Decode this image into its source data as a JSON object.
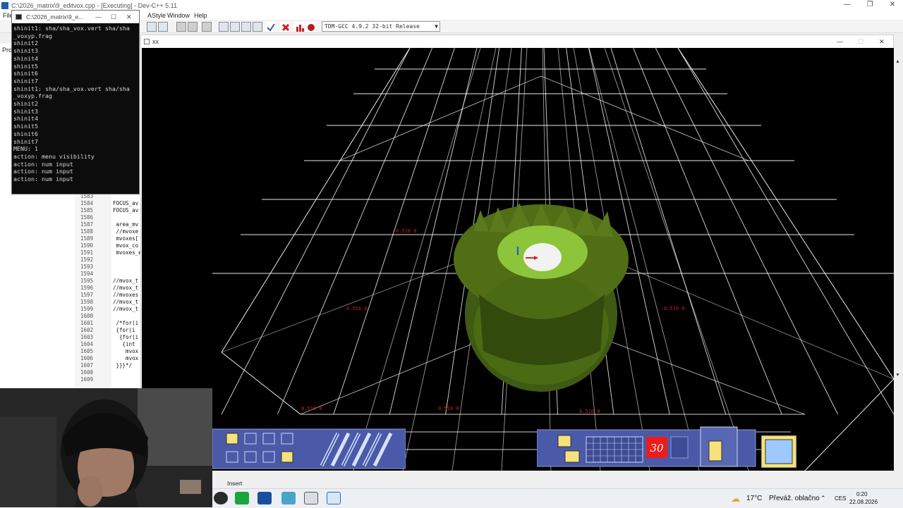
{
  "devcpp": {
    "title": "C:\\2026_matrix\\9_editvox.cpp - [Executing] - Dev-C++ 5.11",
    "menu": [
      "File",
      "AStyle",
      "Window",
      "Help"
    ],
    "compiler": "TDM-GCC 4.9.2 32-bit Release",
    "project_tab": "Pro",
    "status_insert": "Insert"
  },
  "console": {
    "title": "C:\\2026_matrix\\9_e...",
    "lines": [
      "shinit1: sha/sha_vox.vert sha/sha",
      "_voxyp.frag",
      "shinit2",
      "shinit3",
      "shinit4",
      "shinit5",
      "shinit6",
      "shinit7",
      "shinit1: sha/sha_vox.vert sha/sha",
      "_voxyp.frag",
      "shinit2",
      "shinit3",
      "shinit4",
      "shinit5",
      "shinit6",
      "shinit7",
      "MENU: 1",
      "action: menu visibility",
      "action: num input",
      "action: num input",
      "action: num input"
    ]
  },
  "editor": {
    "line_numbers": [
      "1583",
      "1584",
      "1585",
      "1586",
      "1587",
      "1588",
      "1589",
      "1590",
      "1591",
      "1592",
      "1593",
      "1594",
      "1595",
      "1596",
      "1597",
      "1598",
      "1599",
      "1600",
      "1601",
      "1602",
      "1603",
      "1604",
      "1605",
      "1606",
      "1607",
      "1608",
      "1609"
    ],
    "code_lines": [
      "",
      "FOCUS_av",
      "FOCUS_av",
      "",
      " area_mv",
      " //mvoxe",
      " mvoxes[",
      " mvox_co",
      " mvoxes_e",
      "",
      "",
      "",
      "//mvox_t",
      "//mvox_t",
      "//mvoxes",
      "//mvox_t",
      "//mvox_t",
      "",
      " /*for(i",
      " {for(i",
      "  {for(i",
      "   {int",
      "    mvox",
      "    mvox",
      " }}}*/",
      "",
      ""
    ]
  },
  "game": {
    "title": "xx",
    "hud_counter": "30"
  },
  "taskbar": {
    "weather_temp": "17°C",
    "weather_text": "Převáž. oblačno",
    "language": "CES",
    "time": "0:20",
    "date": "22.08.2026"
  },
  "colors": {
    "hud_fill": "#4a5aa8",
    "hud_yellow": "#f5e27a",
    "voxel_green": "#6f8f1e",
    "wire": "#ffffff"
  }
}
